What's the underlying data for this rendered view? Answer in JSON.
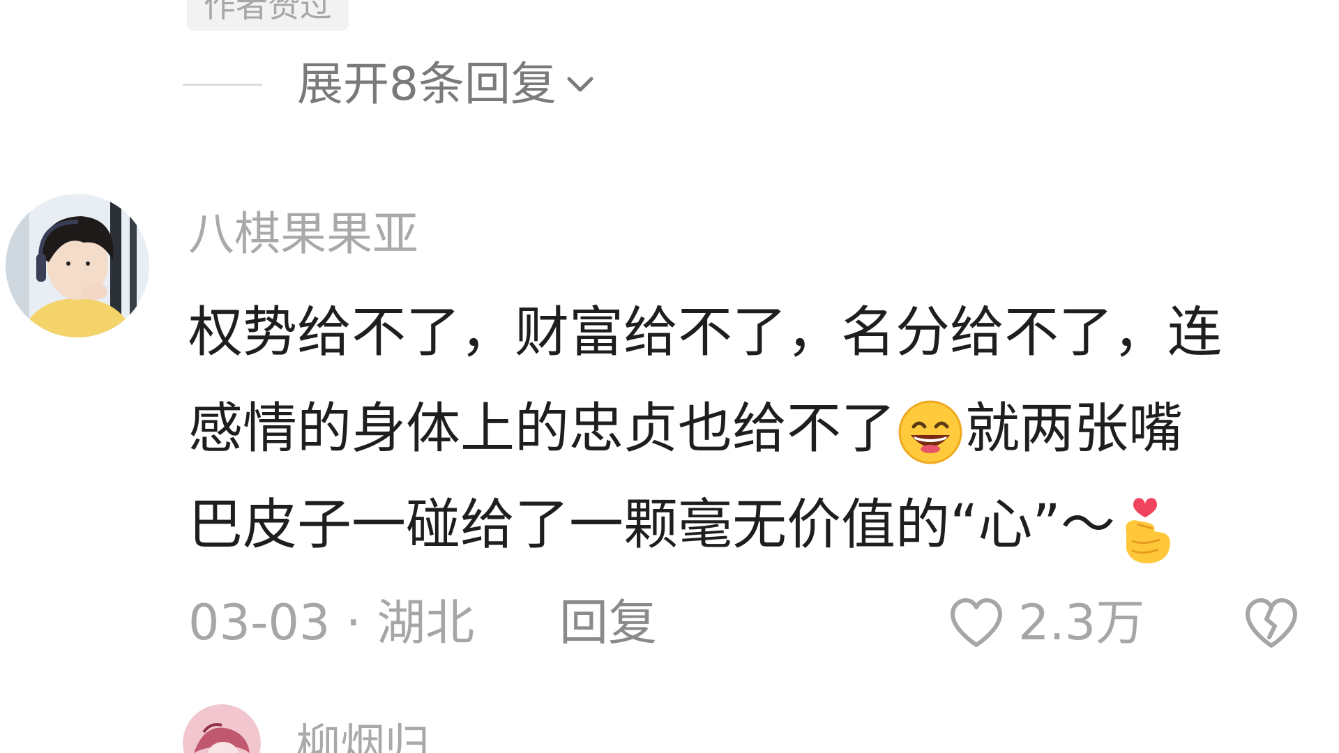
{
  "thread": {
    "author_badge": "作者赞过",
    "expand_replies_label": "展开8条回复"
  },
  "comment": {
    "username": "八棋果果亚",
    "lines": [
      "权势给不了，财富给不了，名分给不了，连",
      "感情的身体上的忠贞也给不了",
      "就两张嘴",
      "巴皮子一碰给了一颗毫无价值的“心”～"
    ],
    "date_location": "03-03 · 湖北",
    "reply_label": "回复",
    "like_count": "2.3万"
  },
  "next_comment": {
    "username": "柳烟归"
  },
  "icons": {
    "expand": "chevron-down-icon",
    "like": "heart-outline-icon",
    "dislike": "broken-heart-icon",
    "emoji_1": "grinning-sweat-emoji",
    "emoji_2": "finger-heart-emoji"
  },
  "colors": {
    "text_primary": "#1e1e1e",
    "text_secondary": "#a6a6a6",
    "badge_bg": "#f2f2f2"
  }
}
